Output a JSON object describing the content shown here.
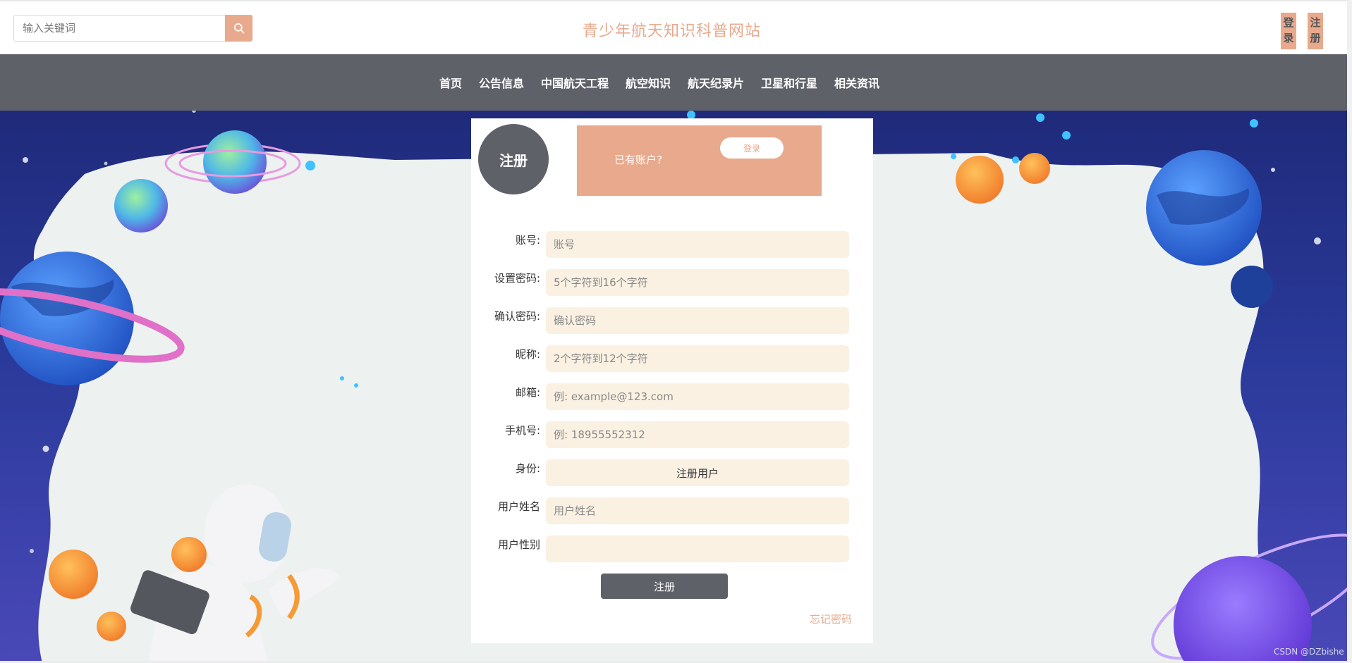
{
  "header": {
    "search_placeholder": "输入关键词",
    "site_title": "青少年航天知识科普网站",
    "login_label": "登录",
    "register_label": "注册"
  },
  "nav": {
    "items": [
      {
        "label": "首页"
      },
      {
        "label": "公告信息"
      },
      {
        "label": "中国航天工程"
      },
      {
        "label": "航空知识"
      },
      {
        "label": "航天纪录片"
      },
      {
        "label": "卫星和行星"
      },
      {
        "label": "相关资讯"
      }
    ]
  },
  "form": {
    "badge": "注册",
    "have_account_text": "已有账户?",
    "login_link": "登录",
    "fields": [
      {
        "label": "账号:",
        "placeholder": "账号",
        "value": ""
      },
      {
        "label": "设置密码:",
        "placeholder": "5个字符到16个字符",
        "value": ""
      },
      {
        "label": "确认密码:",
        "placeholder": "确认密码",
        "value": ""
      },
      {
        "label": "昵称:",
        "placeholder": "2个字符到12个字符",
        "value": ""
      },
      {
        "label": "邮箱:",
        "placeholder": "例: example@123.com",
        "value": ""
      },
      {
        "label": "手机号:",
        "placeholder": "例: 18955552312",
        "value": ""
      },
      {
        "label": "身份:",
        "selected": "注册用户"
      },
      {
        "label": "用户姓名",
        "placeholder": "用户姓名",
        "value": ""
      },
      {
        "label": "用户性别",
        "placeholder": "",
        "value": ""
      }
    ],
    "submit_label": "注册",
    "forgot_label": "忘记密码"
  },
  "watermark": "CSDN @DZbishe",
  "colors": {
    "accent": "#e8a98d",
    "nav_bg": "#5f6168",
    "input_bg": "#faf1e3",
    "space_bg": "#2a3a9a"
  },
  "icons": {
    "search": "search-icon"
  }
}
